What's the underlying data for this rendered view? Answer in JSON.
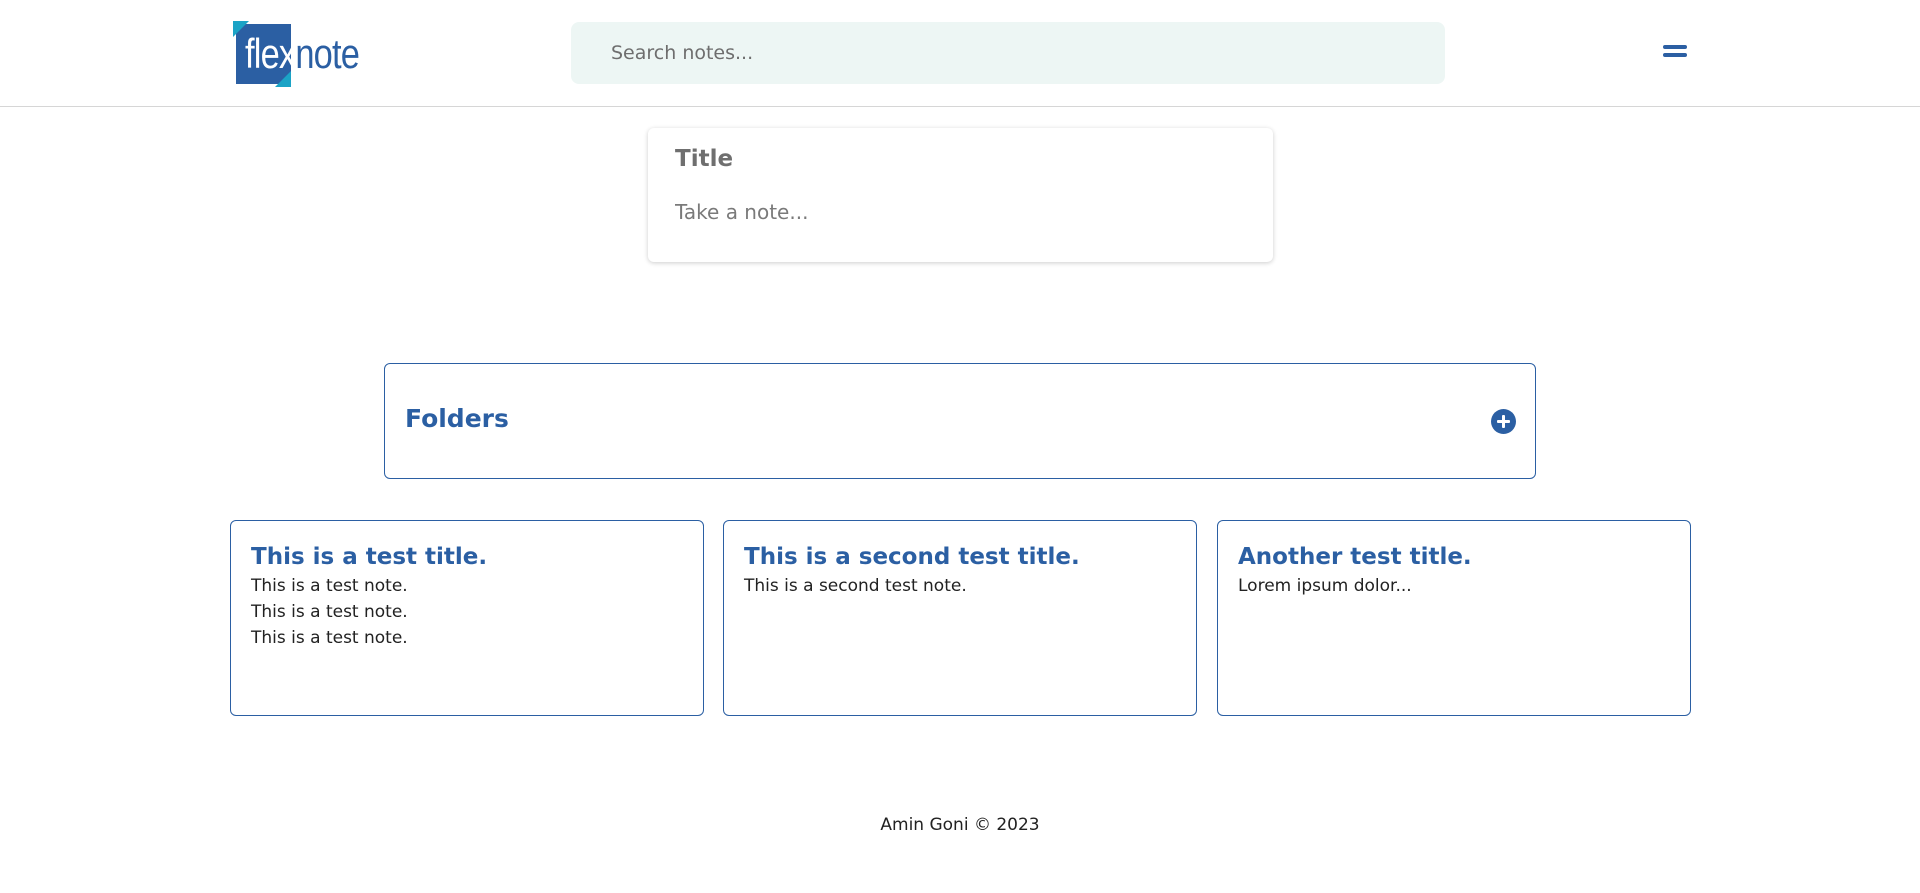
{
  "header": {
    "logo": {
      "part1": "flex",
      "part2": "note"
    },
    "search": {
      "placeholder": "Search notes...",
      "value": ""
    },
    "menu_icon": "hamburger-menu-icon"
  },
  "composer": {
    "title_placeholder": "Title",
    "body_placeholder": "Take a note..."
  },
  "folders": {
    "title": "Folders",
    "add_icon": "plus-circle-icon"
  },
  "notes": [
    {
      "title": "This is a test title.",
      "lines": [
        "This is a test note.",
        "This is a test note.",
        "This is a test note."
      ]
    },
    {
      "title": "This is a second test title.",
      "lines": [
        "This is a second test note."
      ]
    },
    {
      "title": "Another test title.",
      "lines": [
        "Lorem ipsum dolor..."
      ]
    }
  ],
  "footer": {
    "text": "Amin Goni © 2023"
  },
  "colors": {
    "accent": "#2b5fa3",
    "logo_secondary": "#1ba3c6",
    "search_bg": "#edf6f4"
  }
}
